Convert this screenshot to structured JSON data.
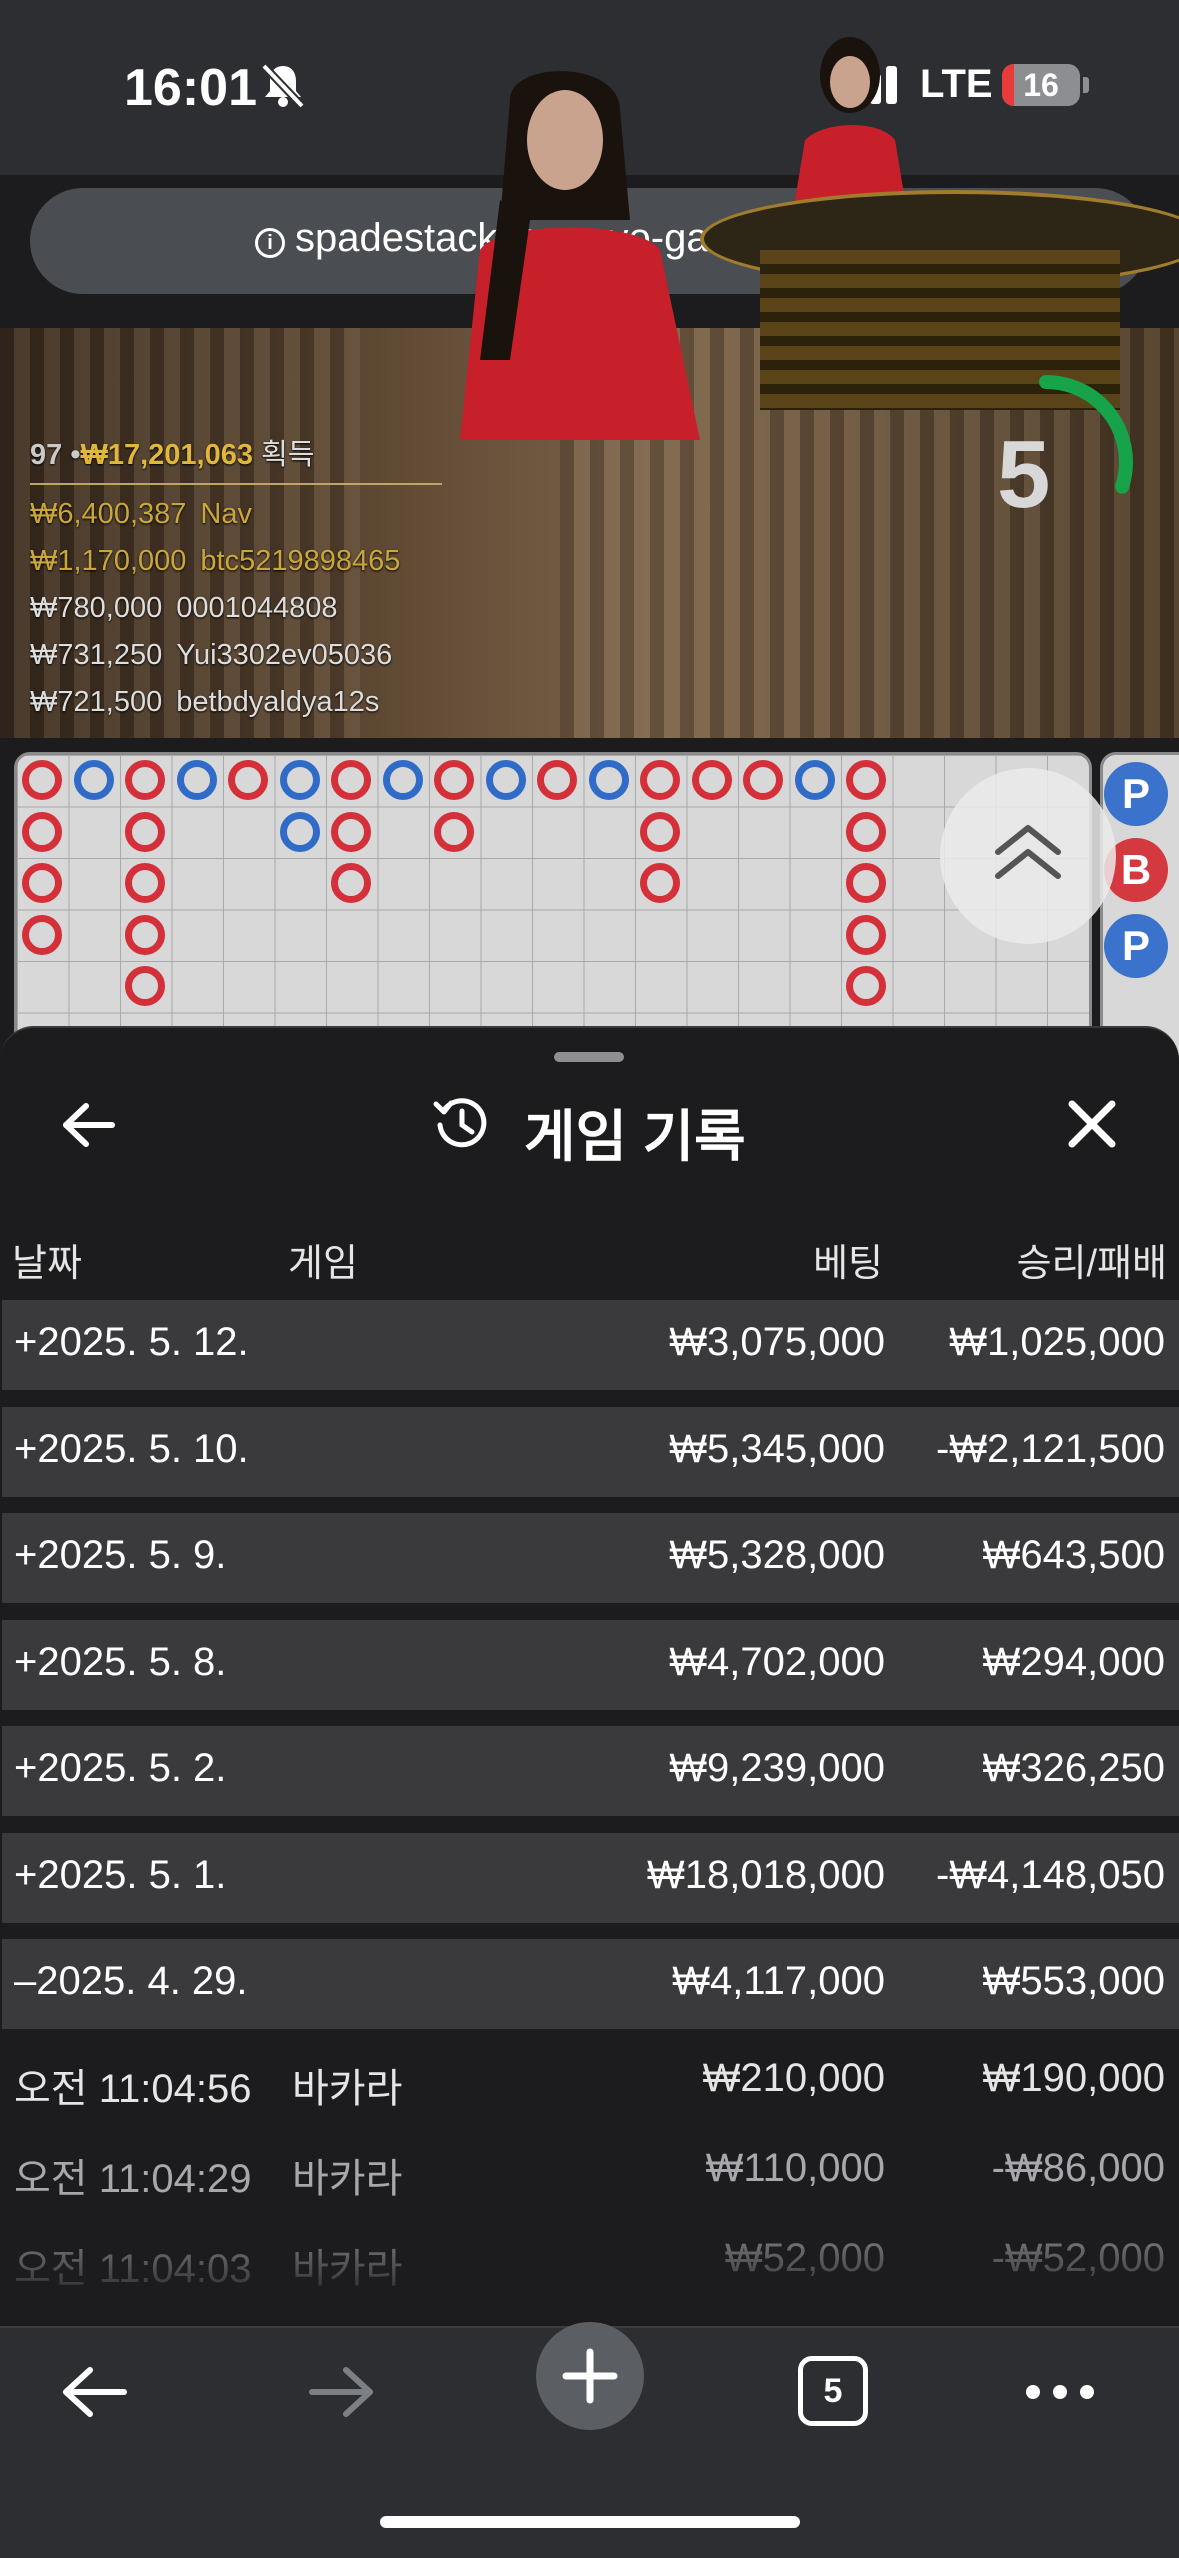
{
  "status": {
    "time": "16:01",
    "network": "LTE",
    "battery": "16",
    "battery_level": 0.16
  },
  "browser": {
    "url": "spadestackcore.evo-games.com",
    "tab_count": "5"
  },
  "live": {
    "timer": "5",
    "timer_progress": 0.3,
    "players": "97",
    "total_won": "₩17,201,063",
    "won_label": "획득",
    "winners": [
      {
        "amount": "₩6,400,387",
        "name": "Nav"
      },
      {
        "amount": "₩1,170,000",
        "name": "btc5219898465"
      },
      {
        "amount": "₩780,000",
        "name": "0001044808"
      },
      {
        "amount": "₩731,250",
        "name": "Yui3302ev05036"
      },
      {
        "amount": "₩721,500",
        "name": "betbdyaldya12s"
      }
    ]
  },
  "roadmap": {
    "predictions": [
      "P",
      "B",
      "P"
    ]
  },
  "history": {
    "title": "게임 기록",
    "columns": {
      "date": "날짜",
      "game": "게임",
      "bet": "베팅",
      "winloss": "승리/패배"
    },
    "days": [
      {
        "date": "+2025. 5. 12.",
        "bet": "₩3,075,000",
        "winloss": "₩1,025,000"
      },
      {
        "date": "+2025. 5. 10.",
        "bet": "₩5,345,000",
        "winloss": "-₩2,121,500"
      },
      {
        "date": "+2025. 5. 9.",
        "bet": "₩5,328,000",
        "winloss": "₩643,500"
      },
      {
        "date": "+2025. 5. 8.",
        "bet": "₩4,702,000",
        "winloss": "₩294,000"
      },
      {
        "date": "+2025. 5. 2.",
        "bet": "₩9,239,000",
        "winloss": "₩326,250"
      },
      {
        "date": "+2025. 5. 1.",
        "bet": "₩18,018,000",
        "winloss": "-₩4,148,050"
      },
      {
        "date": "–2025. 4. 29.",
        "bet": "₩4,117,000",
        "winloss": "₩553,000"
      }
    ],
    "games": [
      {
        "time": "오전 11:04:56",
        "game": "바카라",
        "bet": "₩210,000",
        "winloss": "₩190,000"
      },
      {
        "time": "오전 11:04:29",
        "game": "바카라",
        "bet": "₩110,000",
        "winloss": "-₩86,000"
      },
      {
        "time": "오전 11:04:03",
        "game": "바카라",
        "bet": "₩52,000",
        "winloss": "-₩52,000"
      }
    ]
  }
}
